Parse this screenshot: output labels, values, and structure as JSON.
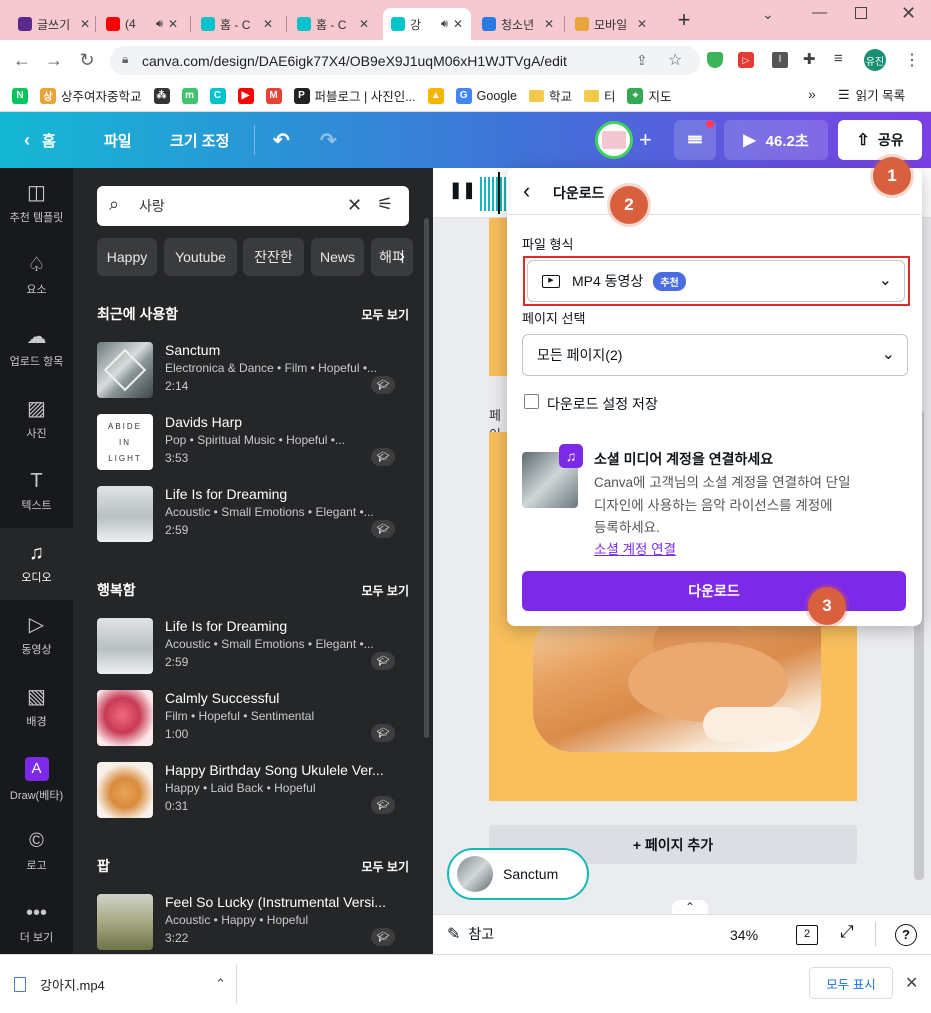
{
  "browser": {
    "tabs": [
      {
        "title": "글쓰기",
        "icon": "dots-icon",
        "color": "#5a2a8a"
      },
      {
        "title": "(4",
        "icon": "youtube-icon",
        "color": "#ff0000"
      },
      {
        "title": "홈 - C",
        "icon": "canva-icon",
        "color": "#00c4cc"
      },
      {
        "title": "홈 - C",
        "icon": "canva-icon",
        "color": "#00c4cc"
      },
      {
        "title": "강",
        "icon": "canva-icon",
        "color": "#00c4cc"
      },
      {
        "title": "청소년",
        "icon": "info-icon",
        "color": "#2a7ae4"
      },
      {
        "title": "모바일",
        "icon": "chrome-icon",
        "color": "#e8a33b"
      }
    ],
    "new_tab": "+",
    "url": "canva.com/design/DAE6igk77X4/OB9eX9J1uqM06xH1WJTVgA/edit",
    "profile": "유진",
    "bookmarks": [
      {
        "label": "",
        "icon": "naver-icon",
        "color": "#03c75a",
        "letter": "N"
      },
      {
        "label": "상주여자중학교",
        "icon": "school-icon",
        "color": "#e8a33b",
        "letter": "상"
      },
      {
        "label": "",
        "icon": "dots-icon",
        "color": "#333333",
        "letter": "⁂"
      },
      {
        "label": "",
        "icon": "m-icon",
        "color": "#3ec46d",
        "letter": "m"
      },
      {
        "label": "",
        "icon": "canva-icon",
        "color": "#00c4cc",
        "letter": "C"
      },
      {
        "label": "",
        "icon": "youtube-icon",
        "color": "#ff0000",
        "letter": "▶"
      },
      {
        "label": "",
        "icon": "gmail-icon",
        "color": "#ea4335",
        "letter": "M"
      },
      {
        "label": "퍼블로그 | 사진인...",
        "icon": "p-icon",
        "color": "#222222",
        "letter": "P"
      },
      {
        "label": "",
        "icon": "drive-icon",
        "color": "#f4b400",
        "letter": "▲"
      },
      {
        "label": "Google",
        "icon": "google-icon",
        "color": "#4285f4",
        "letter": "G"
      },
      {
        "label": "학교",
        "icon": "folder-icon",
        "color": "#f3c94b",
        "letter": ""
      },
      {
        "label": "티",
        "icon": "folder-icon",
        "color": "#f3c94b",
        "letter": ""
      },
      {
        "label": "지도",
        "icon": "maps-icon",
        "color": "#34a853",
        "letter": "⌖"
      }
    ],
    "bookmarks_more": "»",
    "reading_list": "읽기 목록"
  },
  "header": {
    "home": "홈",
    "file": "파일",
    "resize": "크기 조정",
    "timer": "46.2초",
    "share": "공유"
  },
  "rail": [
    {
      "label": "추천 템플릿",
      "icon": "template-icon",
      "glyph": "◫"
    },
    {
      "label": "요소",
      "icon": "elements-icon",
      "glyph": "♤"
    },
    {
      "label": "업로드 항목",
      "icon": "upload-icon",
      "glyph": "☁"
    },
    {
      "label": "사진",
      "icon": "photo-icon",
      "glyph": "▨"
    },
    {
      "label": "텍스트",
      "icon": "text-icon",
      "glyph": "T"
    },
    {
      "label": "오디오",
      "icon": "audio-icon",
      "glyph": "♫"
    },
    {
      "label": "동영상",
      "icon": "video-icon",
      "glyph": "▷"
    },
    {
      "label": "배경",
      "icon": "background-icon",
      "glyph": "▧"
    },
    {
      "label": "Draw(베타)",
      "icon": "draw-icon",
      "glyph": "A"
    },
    {
      "label": "로고",
      "icon": "logo-icon",
      "glyph": "©"
    },
    {
      "label": "더 보기",
      "icon": "more-icon",
      "glyph": "•••"
    }
  ],
  "panel": {
    "search_value": "사랑",
    "chips": [
      "Happy",
      "Youtube",
      "잔잔한",
      "News",
      "해피"
    ],
    "sections": [
      {
        "title": "최근에 사용함",
        "see_all": "모두 보기",
        "tracks": [
          {
            "title": "Sanctum",
            "meta": "Electronica & Dance • Film • Hopeful •...",
            "duration": "2:14",
            "thumb": "sanctum"
          },
          {
            "title": "Davids Harp",
            "meta": "Pop • Spiritual Music • Hopeful •...",
            "duration": "3:53",
            "thumb": "abide"
          },
          {
            "title": "Life Is for Dreaming",
            "meta": "Acoustic • Small Emotions • Elegant •...",
            "duration": "2:59",
            "thumb": "sky"
          }
        ]
      },
      {
        "title": "행복함",
        "see_all": "모두 보기",
        "tracks": [
          {
            "title": "Life Is for Dreaming",
            "meta": "Acoustic • Small Emotions • Elegant •...",
            "duration": "2:59",
            "thumb": "sky"
          },
          {
            "title": "Calmly Successful",
            "meta": "Film • Hopeful • Sentimental",
            "duration": "1:00",
            "thumb": "smoke"
          },
          {
            "title": "Happy Birthday Song Ukulele Ver...",
            "meta": "Happy • Laid Back • Hopeful",
            "duration": "0:31",
            "thumb": "dog"
          }
        ]
      },
      {
        "title": "팝",
        "see_all": "모두 보기",
        "tracks": [
          {
            "title": "Feel So Lucky (Instrumental Versi...",
            "meta": "Acoustic • Happy • Hopeful",
            "duration": "3:22",
            "thumb": "forest"
          }
        ]
      }
    ],
    "abide_text": [
      "ABIDE",
      "IN",
      "LIGHT"
    ]
  },
  "canvas": {
    "page_label": "페이",
    "add_page": "+ 페이지 추가",
    "playing_audio": "Sanctum",
    "notes": "참고",
    "zoom": "34%",
    "page_count": "2"
  },
  "download": {
    "title": "다운로드",
    "file_type_label": "파일 형식",
    "file_type_value": "MP4 동영상",
    "recommended": "추천",
    "page_select_label": "페이지 선택",
    "page_select_value": "모든 페이지(2)",
    "save_settings": "다운로드 설정 저장",
    "social_title": "소셜 미디어 계정을 연결하세요",
    "social_body_1": "Canva에 고객님의 소셜 계정을 연결하여 단일",
    "social_body_2": "디자인에 사용하는 음악 라이선스를 계정에",
    "social_body_3": "등록하세요.",
    "social_link": "소셜 계정 연결",
    "download_button": "다운로드"
  },
  "steps": [
    "1",
    "2",
    "3"
  ],
  "shelf": {
    "file_name": "강아지.mp4",
    "show_all": "모두 표시"
  },
  "colors": {
    "accent_purple": "#7d2ae8",
    "step_orange": "#d9603f",
    "highlight_red": "#e0292b",
    "canvas_orange": "#f9bf5c"
  }
}
